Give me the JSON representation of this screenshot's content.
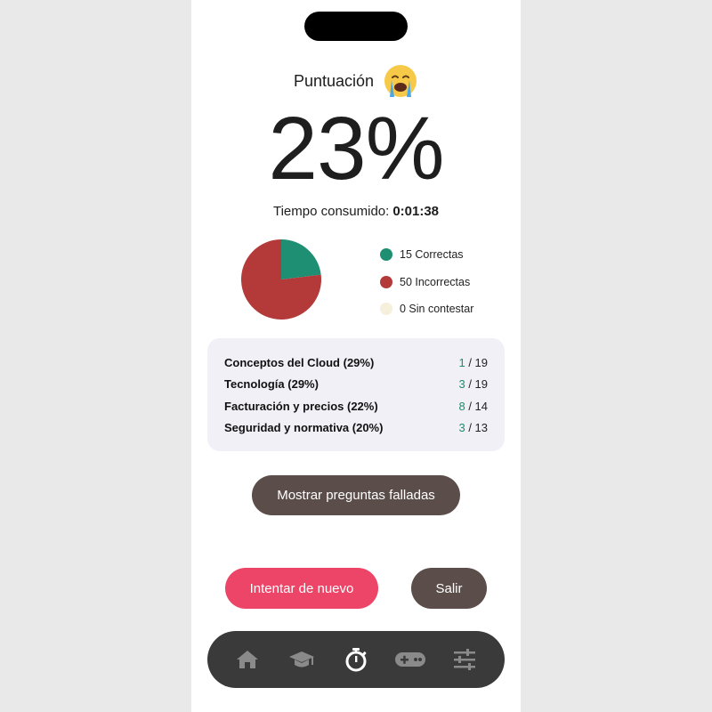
{
  "score": {
    "label": "Puntuación",
    "emoji": "crying-face",
    "percent": "23%"
  },
  "time": {
    "label": "Tiempo consumido:",
    "value": "0:01:38"
  },
  "results": {
    "correct": 15,
    "incorrect": 50,
    "unanswered": 0,
    "colors": {
      "correct": "#1f8f73",
      "incorrect": "#b43a3a",
      "unanswered": "#f5efdc"
    }
  },
  "legend": [
    {
      "label": "15 Correctas",
      "color": "#1f8f73"
    },
    {
      "label": "50 Incorrectas",
      "color": "#b43a3a"
    },
    {
      "label": "0 Sin contestar",
      "color": "#f5efdc"
    }
  ],
  "categories": [
    {
      "name": "Conceptos del Cloud (29%)",
      "correct": "1",
      "total": " / 19"
    },
    {
      "name": "Tecnología (29%)",
      "correct": "3",
      "total": " / 19"
    },
    {
      "name": "Facturación y precios (22%)",
      "correct": "8",
      "total": " / 14"
    },
    {
      "name": "Seguridad y normativa (20%)",
      "correct": "3",
      "total": " / 13"
    }
  ],
  "buttons": {
    "show_wrong": "Mostrar preguntas falladas",
    "retry": "Intentar de nuevo",
    "exit": "Salir"
  },
  "tabbar": {
    "items": [
      "home-icon",
      "graduation-cap-icon",
      "stopwatch-icon",
      "gamepad-icon",
      "sliders-icon"
    ],
    "active": "stopwatch-icon"
  }
}
